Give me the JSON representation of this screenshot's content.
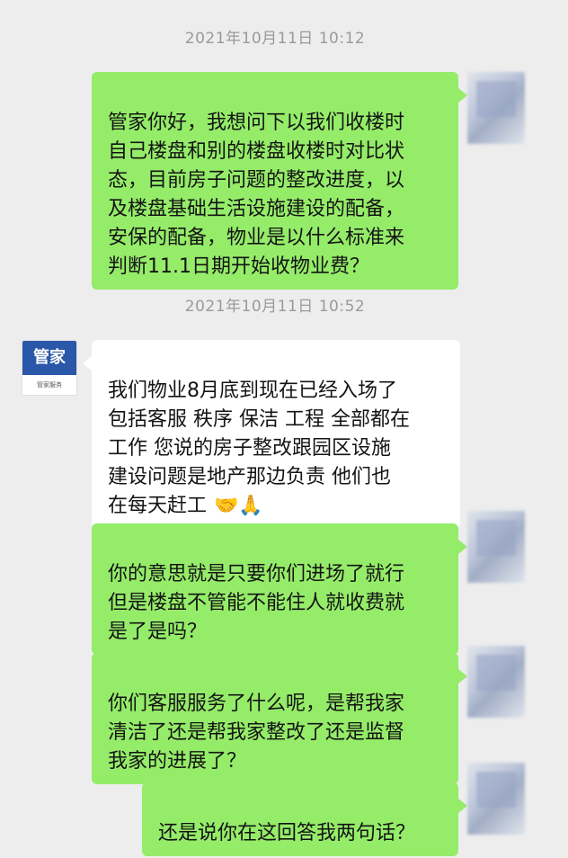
{
  "timestamps": [
    "2021年10月11日 10:12",
    "2021年10月11日 10:52"
  ],
  "contact": {
    "avatar_text": "管家",
    "avatar_subtext": "管家服务"
  },
  "messages": [
    {
      "side": "out",
      "text": "管家你好，我想问下以我们收楼时\n自己楼盘和别的楼盘收楼时对比状\n态，目前房子问题的整改进度，以\n及楼盘基础生活设施建设的配备，\n安保的配备，物业是以什么标准来\n判断11.1日期开始收物业费？"
    },
    {
      "side": "in",
      "text": "我们物业8月底到现在已经入场了\n包括客服 秩序 保洁 工程 全部都在\n工作  您说的房子整改跟园区设施\n建设问题是地产那边负责 他们也\n在每天赶工",
      "emoji": "🤝🙏"
    },
    {
      "side": "out",
      "text": "你的意思就是只要你们进场了就行\n但是楼盘不管能不能住人就收费就\n是了是吗？"
    },
    {
      "side": "out",
      "text": "你们客服服务了什么呢，是帮我家\n清洁了还是帮我家整改了还是监督\n我家的进展了？"
    },
    {
      "side": "out",
      "text": "还是说你在这回答我两句话？"
    }
  ],
  "colors": {
    "outgoing_bubble": "#95ec69",
    "incoming_bubble": "#ffffff",
    "background": "#ededed"
  }
}
